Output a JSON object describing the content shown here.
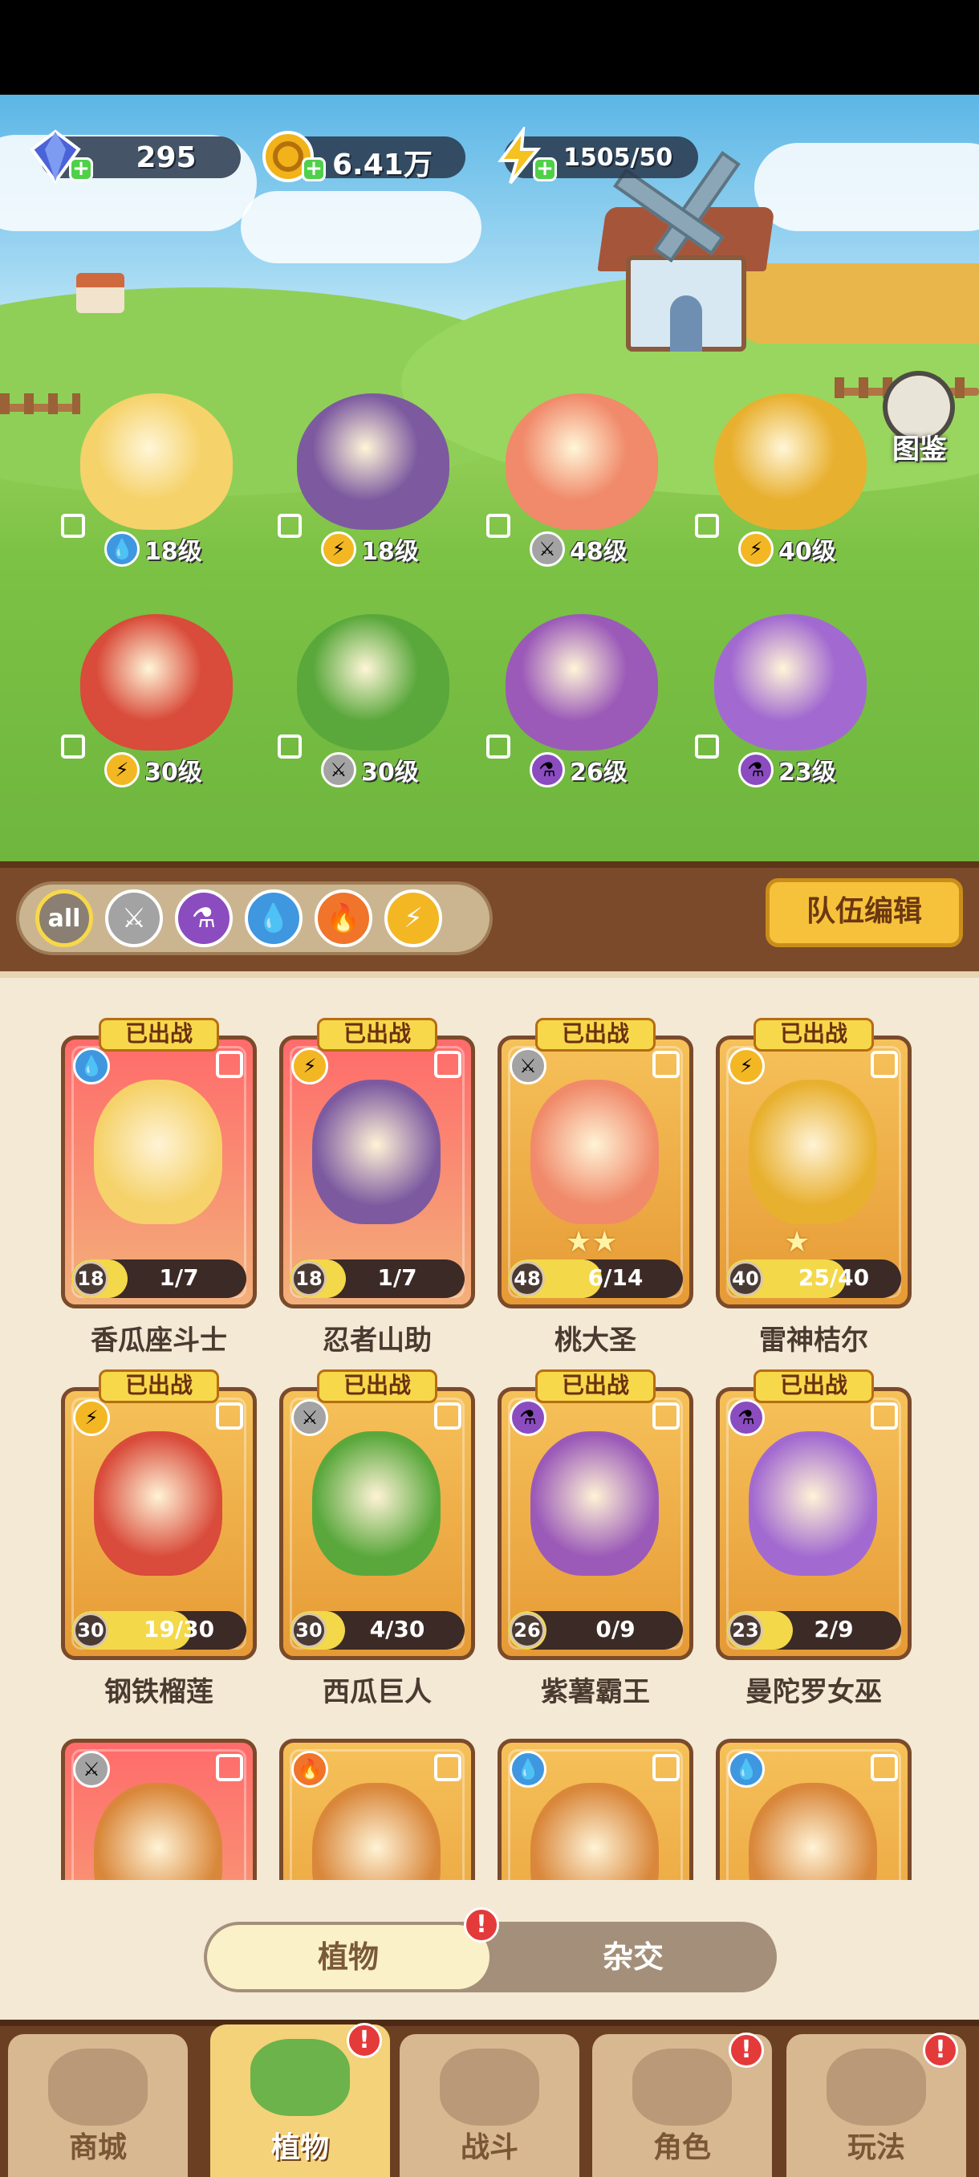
{
  "resources": {
    "gems": "295",
    "coins": "6.41万",
    "energy": "1505/50"
  },
  "codex_label": "图鉴",
  "team": [
    {
      "element": "water",
      "level": "18级",
      "color": "#f5d26a"
    },
    {
      "element": "lightning",
      "level": "18级",
      "color": "#7d5aa0"
    },
    {
      "element": "sword",
      "level": "48级",
      "color": "#f08a6a"
    },
    {
      "element": "lightning",
      "level": "40级",
      "color": "#e8b02f"
    },
    {
      "element": "lightning",
      "level": "30级",
      "color": "#d94b3a"
    },
    {
      "element": "sword",
      "level": "30级",
      "color": "#5aa83c"
    },
    {
      "element": "poison",
      "level": "26级",
      "color": "#9b5ab8"
    },
    {
      "element": "poison",
      "level": "23级",
      "color": "#a26ad0"
    }
  ],
  "filters": [
    {
      "name": "all",
      "label": "all",
      "color": "#8a7f72"
    },
    {
      "name": "sword",
      "label": "",
      "color": "#a3a3a3"
    },
    {
      "name": "poison",
      "label": "",
      "color": "#8b4cc0"
    },
    {
      "name": "water",
      "label": "",
      "color": "#3f97e0"
    },
    {
      "name": "fire",
      "label": "",
      "color": "#f0742a"
    },
    {
      "name": "lightning",
      "label": "",
      "color": "#f3b724"
    }
  ],
  "team_edit_label": "队伍编辑",
  "badge_deployed": "已出战",
  "cards": [
    {
      "name": "香瓜座斗士",
      "level": "18",
      "progress": "1/7",
      "fill": 0.14,
      "style": "red",
      "deployed": true,
      "element": "water",
      "stars": ""
    },
    {
      "name": "忍者山助",
      "level": "18",
      "progress": "1/7",
      "fill": 0.14,
      "style": "red",
      "deployed": true,
      "element": "lightning",
      "stars": ""
    },
    {
      "name": "桃大圣",
      "level": "48",
      "progress": "6/14",
      "fill": 0.43,
      "style": "gold",
      "deployed": true,
      "element": "sword",
      "stars": "★★"
    },
    {
      "name": "雷神桔尔",
      "level": "40",
      "progress": "25/40",
      "fill": 0.63,
      "style": "gold",
      "deployed": true,
      "element": "lightning",
      "stars": "★"
    },
    {
      "name": "钢铁榴莲",
      "level": "30",
      "progress": "19/30",
      "fill": 0.63,
      "style": "gold",
      "deployed": true,
      "element": "lightning",
      "stars": ""
    },
    {
      "name": "西瓜巨人",
      "level": "30",
      "progress": "4/30",
      "fill": 0.13,
      "style": "gold",
      "deployed": true,
      "element": "sword",
      "stars": ""
    },
    {
      "name": "紫薯霸王",
      "level": "26",
      "progress": "0/9",
      "fill": 0.0,
      "style": "gold",
      "deployed": true,
      "element": "poison",
      "stars": ""
    },
    {
      "name": "曼陀罗女巫",
      "level": "23",
      "progress": "2/9",
      "fill": 0.22,
      "style": "gold",
      "deployed": true,
      "element": "poison",
      "stars": ""
    },
    {
      "name": "",
      "level": "",
      "progress": "",
      "fill": 0,
      "style": "red",
      "deployed": false,
      "element": "sword",
      "stars": ""
    },
    {
      "name": "",
      "level": "",
      "progress": "",
      "fill": 0,
      "style": "gold",
      "deployed": false,
      "element": "fire",
      "stars": ""
    },
    {
      "name": "",
      "level": "",
      "progress": "",
      "fill": 0,
      "style": "gold",
      "deployed": false,
      "element": "water",
      "stars": ""
    },
    {
      "name": "",
      "level": "",
      "progress": "",
      "fill": 0,
      "style": "gold",
      "deployed": false,
      "element": "water",
      "stars": ""
    }
  ],
  "toggle": {
    "active": "植物",
    "inactive": "杂交"
  },
  "nav": [
    {
      "name": "shop",
      "label": "商城",
      "active": false,
      "alert": false
    },
    {
      "name": "plants",
      "label": "植物",
      "active": true,
      "alert": true
    },
    {
      "name": "battle",
      "label": "战斗",
      "active": false,
      "alert": false
    },
    {
      "name": "character",
      "label": "角色",
      "active": false,
      "alert": true
    },
    {
      "name": "gameplay",
      "label": "玩法",
      "active": false,
      "alert": true
    }
  ],
  "alert_mark": "!",
  "element_colors": {
    "water": "#3f97e0",
    "lightning": "#f3b724",
    "sword": "#a3a3a3",
    "poison": "#8b4cc0",
    "fire": "#f0742a"
  },
  "element_glyphs": {
    "water": "💧",
    "lightning": "⚡",
    "sword": "⚔",
    "poison": "⚗",
    "fire": "🔥"
  }
}
